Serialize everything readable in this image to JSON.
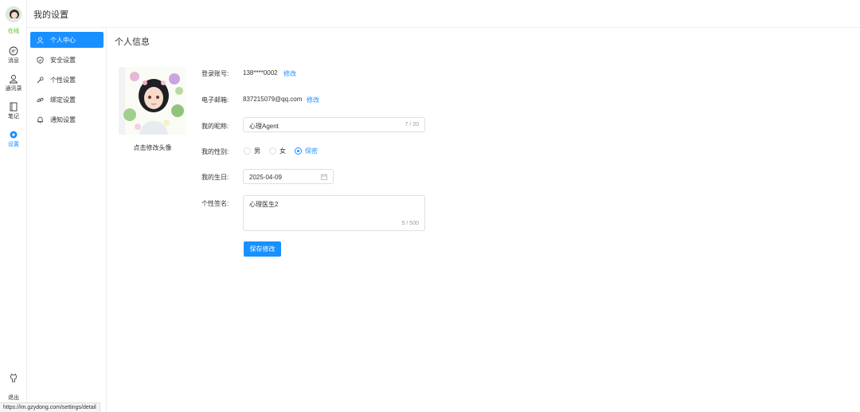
{
  "rail": {
    "status": "在线",
    "items": [
      {
        "icon": "chat-icon",
        "label": "消息"
      },
      {
        "icon": "contacts-icon",
        "label": "通讯录"
      },
      {
        "icon": "notebook-icon",
        "label": "笔记"
      },
      {
        "icon": "gear-icon",
        "label": "设置"
      }
    ],
    "bottom_icon": "github-icon",
    "logout": "退出"
  },
  "header": {
    "title": "我的设置"
  },
  "sidebar": {
    "items": [
      {
        "icon": "user-icon",
        "label": "个人中心"
      },
      {
        "icon": "shield-icon",
        "label": "安全设置"
      },
      {
        "icon": "wrench-icon",
        "label": "个性设置"
      },
      {
        "icon": "link-icon",
        "label": "绑定设置"
      },
      {
        "icon": "bell-icon",
        "label": "通知设置"
      }
    ]
  },
  "section": {
    "title": "个人信息"
  },
  "avatar": {
    "caption": "点击修改头像"
  },
  "form": {
    "account_label": "登录账号:",
    "account_value": "138****0002",
    "account_edit": "修改",
    "email_label": "电子邮箱:",
    "email_value": "837215079@qq.com",
    "email_edit": "修改",
    "nickname_label": "我的昵称:",
    "nickname_value": "心理Agent",
    "nickname_count": "7 / 20",
    "gender_label": "我的性别:",
    "gender_options": [
      "男",
      "女",
      "保密"
    ],
    "gender_selected": "保密",
    "birthday_label": "我的生日:",
    "birthday_value": "2025-04-09",
    "signature_label": "个性签名:",
    "signature_value": "心理医生2",
    "signature_count": "5 / 500",
    "save_label": "保存修改"
  },
  "statusbar": {
    "url": "https://im.gzydong.com/settings/detail"
  },
  "colors": {
    "accent": "#1890ff",
    "online": "#52c41a"
  }
}
